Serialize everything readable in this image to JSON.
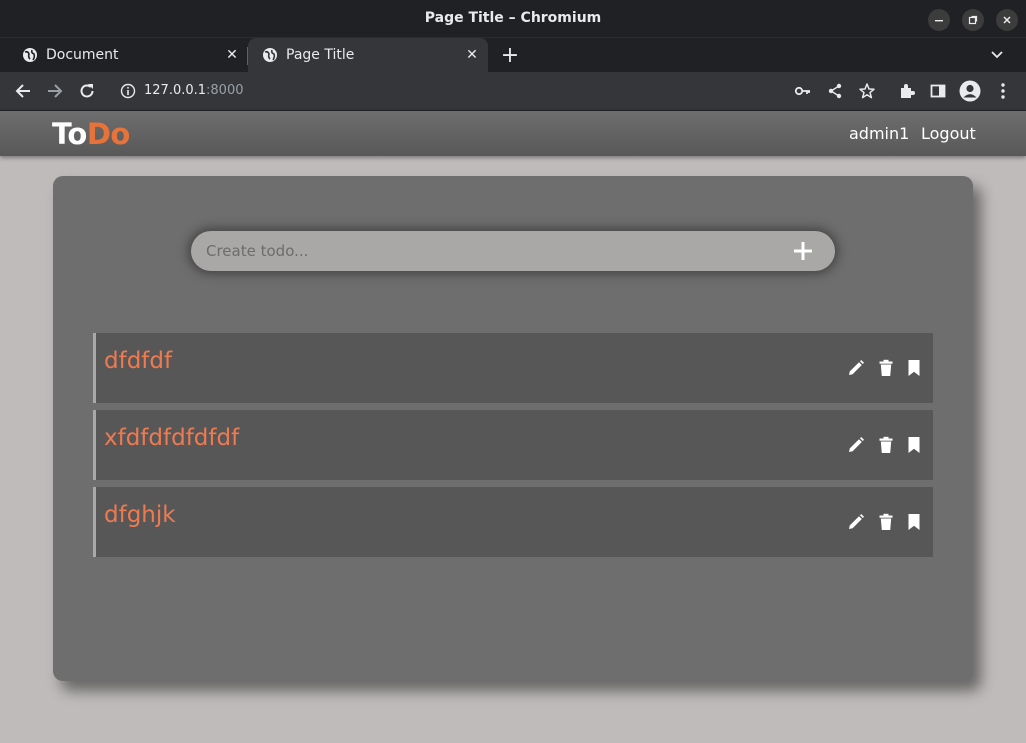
{
  "window": {
    "title": "Page Title – Chromium",
    "minimize_label": "–",
    "maximize_label": "▫",
    "close_label": "✕"
  },
  "tabs": [
    {
      "label": "Document",
      "close": "✕"
    },
    {
      "label": "Page Title",
      "close": "✕"
    }
  ],
  "new_tab_label": "+",
  "address": {
    "host": "127.0.0.1",
    "port": ":8000"
  },
  "app": {
    "brand_to": "To",
    "brand_do": "Do",
    "username": "admin1",
    "logout_label": "Logout",
    "create_placeholder": "Create todo...",
    "add_label": "+",
    "colors": {
      "accent": "#e8733a",
      "todo_text": "#f07a50",
      "card": "#6e6e6e",
      "item": "#575757"
    },
    "todos": [
      {
        "text": "dfdfdf"
      },
      {
        "text": "xfdfdfdfdfdf"
      },
      {
        "text": "dfghjk"
      }
    ]
  }
}
